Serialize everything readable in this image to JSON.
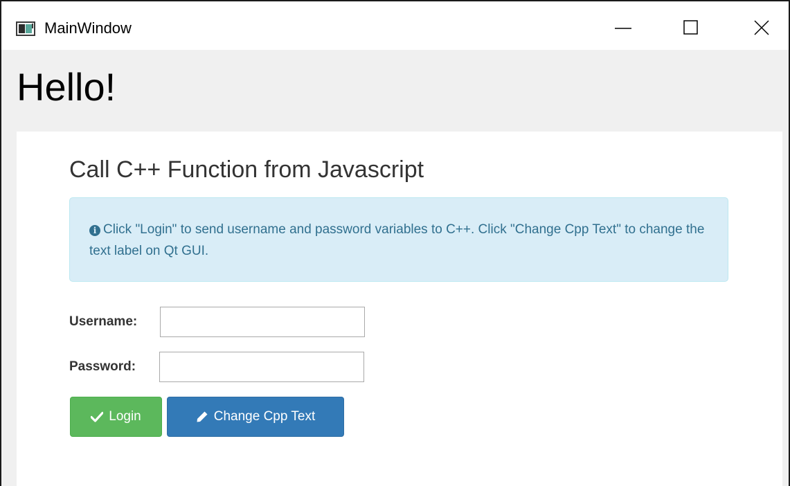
{
  "window": {
    "title": "MainWindow",
    "controls": {
      "minimize_icon": "minimize-icon",
      "maximize_icon": "maximize-icon",
      "close_icon": "close-icon"
    }
  },
  "main": {
    "hello_label": "Hello!"
  },
  "webview": {
    "heading": "Call C++ Function from Javascript",
    "alert": {
      "icon": "info-circle-icon",
      "text": "Click \"Login\" to send username and password variables to C++. Click \"Change Cpp Text\" to change the text label on Qt GUI."
    },
    "form": {
      "username_label": "Username:",
      "username_value": "",
      "password_label": "Password:",
      "password_value": ""
    },
    "buttons": {
      "login_label": "Login",
      "login_icon": "check-icon",
      "change_label": "Change Cpp Text",
      "change_icon": "pencil-icon"
    }
  },
  "colors": {
    "success": "#5cb85c",
    "primary": "#337ab7",
    "info_bg": "#d9edf7",
    "info_text": "#31708f"
  }
}
